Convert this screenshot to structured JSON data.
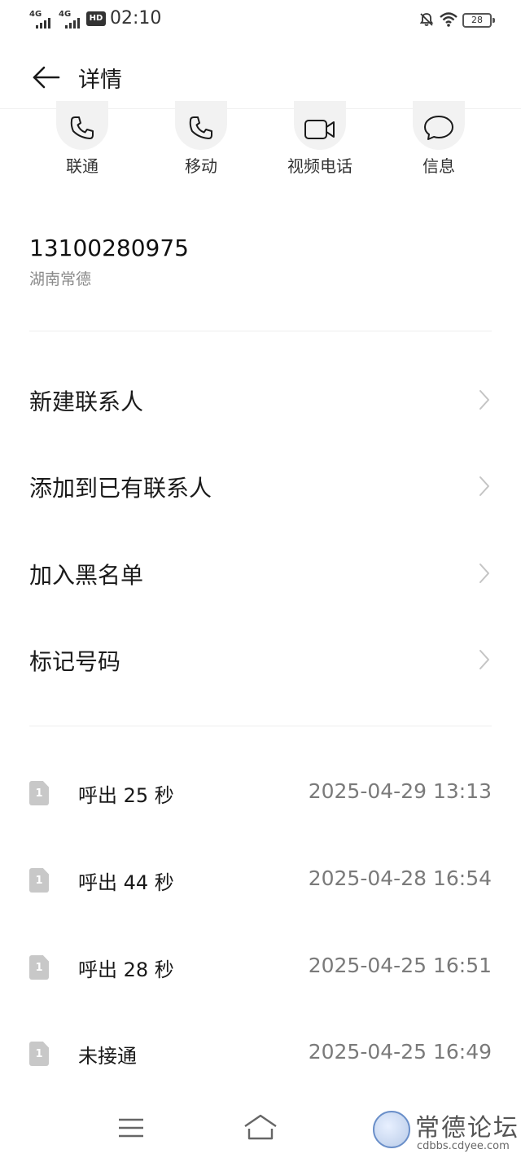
{
  "status_bar": {
    "signal1": "4G",
    "signal2": "4G",
    "hd": "HD",
    "time": "02:10",
    "battery": "28"
  },
  "header": {
    "title": "详情"
  },
  "actions": [
    {
      "label": "联通",
      "icon": "phone-icon"
    },
    {
      "label": "移动",
      "icon": "phone-icon"
    },
    {
      "label": "视频电话",
      "icon": "video-icon"
    },
    {
      "label": "信息",
      "icon": "message-icon"
    }
  ],
  "contact": {
    "number": "13100280975",
    "location": "湖南常德"
  },
  "menu": [
    {
      "label": "新建联系人"
    },
    {
      "label": "添加到已有联系人"
    },
    {
      "label": "加入黑名单"
    },
    {
      "label": "标记号码"
    }
  ],
  "records": [
    {
      "sim": "1",
      "type": "呼出 25 秒",
      "time": "2025-04-29 13:13"
    },
    {
      "sim": "1",
      "type": "呼出 44 秒",
      "time": "2025-04-28 16:54"
    },
    {
      "sim": "1",
      "type": "呼出 28 秒",
      "time": "2025-04-25 16:51"
    },
    {
      "sim": "1",
      "type": "未接通",
      "time": "2025-04-25 16:49"
    }
  ],
  "watermark": {
    "title": "常德论坛",
    "subtitle": "cdbbs.cdyee.com"
  }
}
